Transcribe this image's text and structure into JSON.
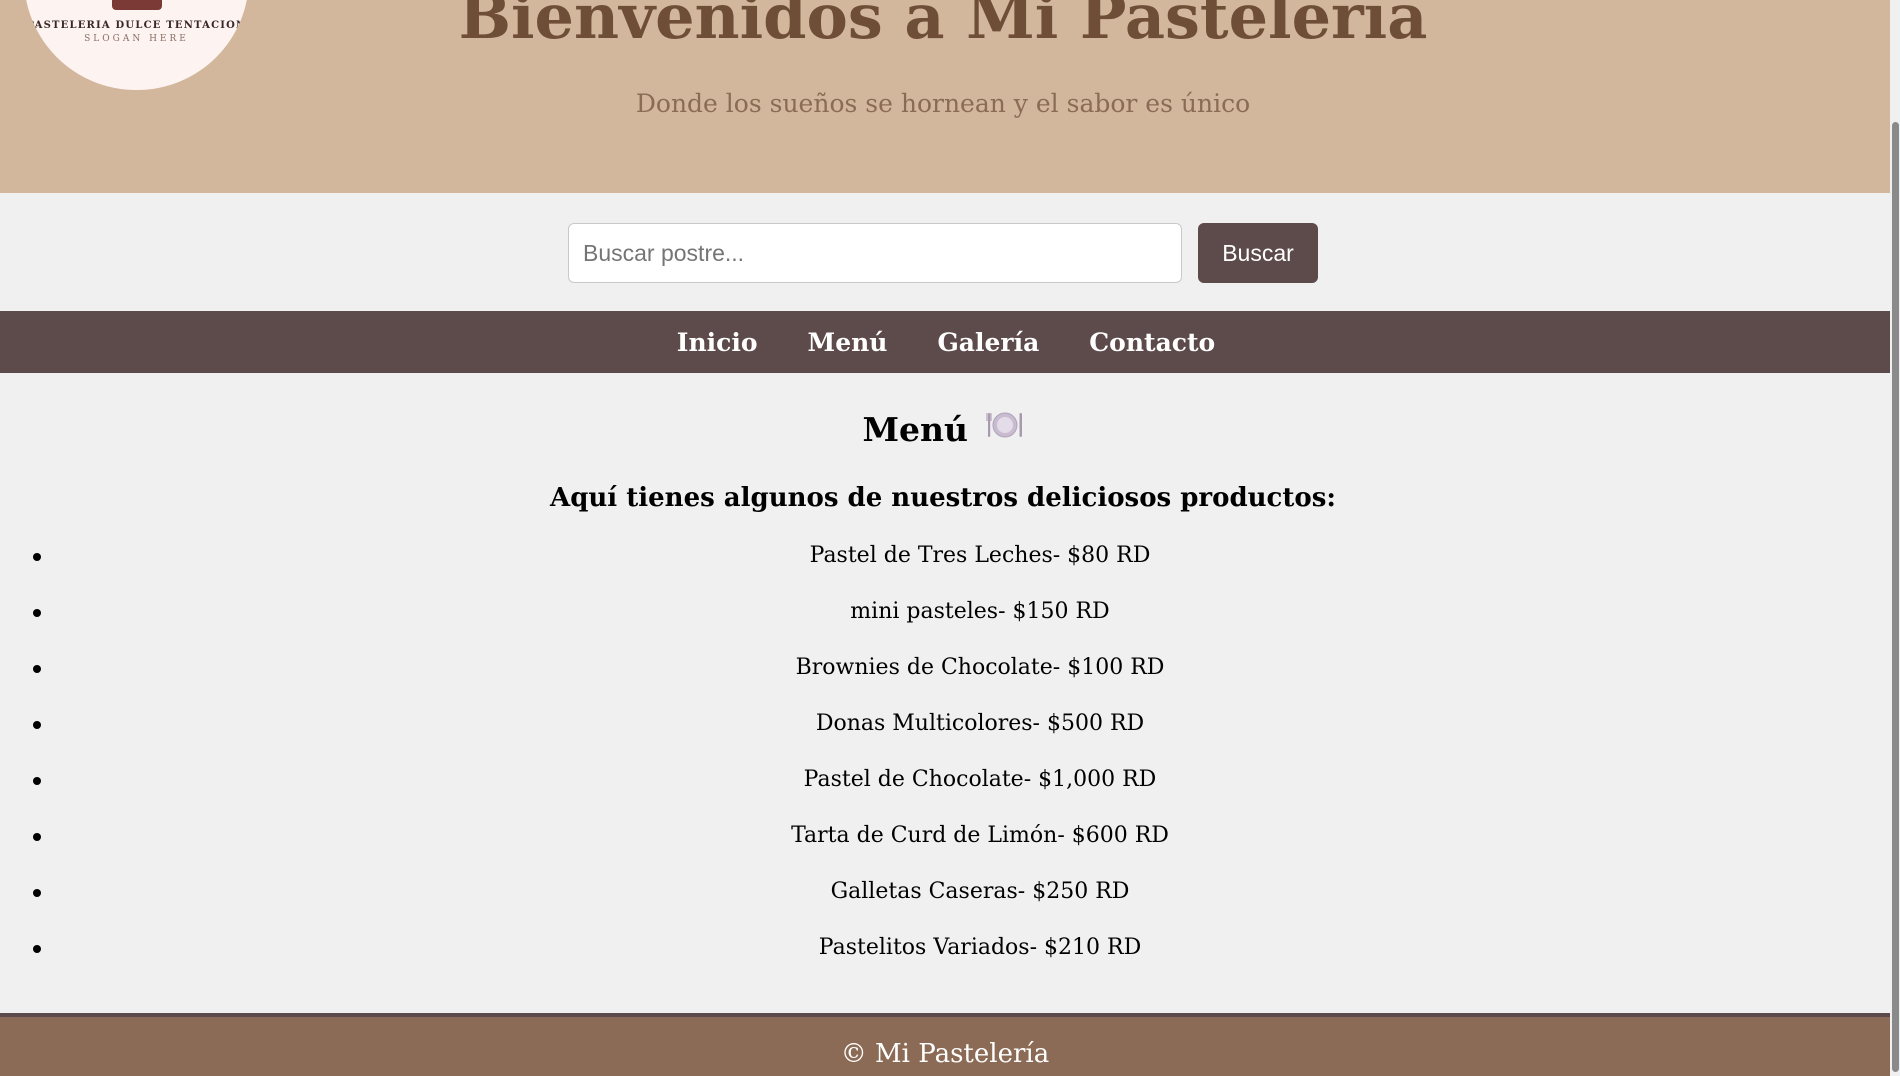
{
  "header": {
    "logo": {
      "brand": "PASTELERIA DULCE TENTACION",
      "slogan": "SLOGAN HERE"
    },
    "title": "Bienvenidos a Mi Pastelería",
    "subtitle": "Donde los sueños se hornean y el sabor es único"
  },
  "search": {
    "placeholder": "Buscar postre...",
    "value": "",
    "button_label": "Buscar"
  },
  "nav": {
    "items": [
      {
        "label": "Inicio"
      },
      {
        "label": "Menú"
      },
      {
        "label": "Galería"
      },
      {
        "label": "Contacto"
      }
    ]
  },
  "main": {
    "heading": "Menú",
    "heading_icon": "plate-with-cutlery-icon",
    "intro": "Aquí tienes algunos de nuestros deliciosos productos:",
    "products": [
      "Pastel de Tres Leches- $80 RD",
      "mini pasteles- $150 RD",
      "Brownies de Chocolate- $100 RD",
      "Donas Multicolores- $500 RD",
      "Pastel de Chocolate- $1,000 RD",
      "Tarta de Curd de Limón- $600 RD",
      "Galletas Caseras- $250 RD",
      "Pastelitos Variados- $210 RD"
    ]
  },
  "footer": {
    "text": "© Mi Pastelería"
  },
  "colors": {
    "header_bg": "#d2b79c",
    "title": "#6f4e37",
    "nav_bg": "#5d4a4a",
    "footer_bg": "#8b6b55",
    "page_bg": "#f0f0f0"
  }
}
